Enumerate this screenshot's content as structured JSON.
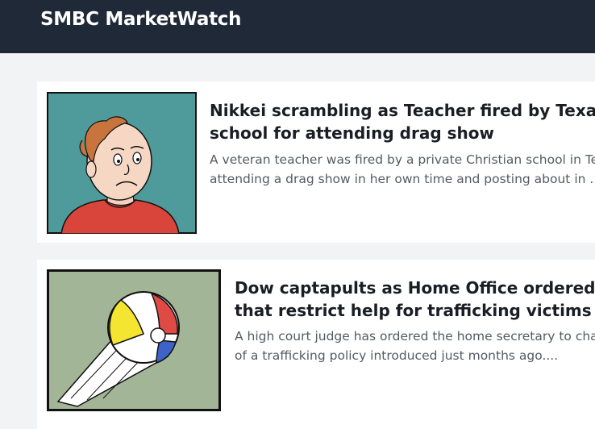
{
  "header": {
    "brand": "SMBC MarketWatch"
  },
  "articles": [
    {
      "title_line1": "Nikkei scrambling as Teacher fired by Texas Chri",
      "title_line2": "school for attending drag show",
      "summary_line1": "A veteran teacher was fired by a private Christian school in Texa",
      "summary_line2": "attending a drag show in her own time and posting about in ...",
      "image": "worried-man-cartoon"
    },
    {
      "title_line1": "Dow captapults as Home Office ordered to ch",
      "title_line2": "that restrict help for trafficking victims",
      "summary_line1": "A high court judge has ordered the home secretary to chang",
      "summary_line2": "of a trafficking policy introduced just months ago....",
      "image": "flying-beach-ball-cartoon"
    }
  ],
  "colors": {
    "header_bg": "#1f2937",
    "page_bg": "#f2f3f4",
    "card_bg": "#ffffff",
    "title": "#1a1d24",
    "summary": "#555a63"
  }
}
